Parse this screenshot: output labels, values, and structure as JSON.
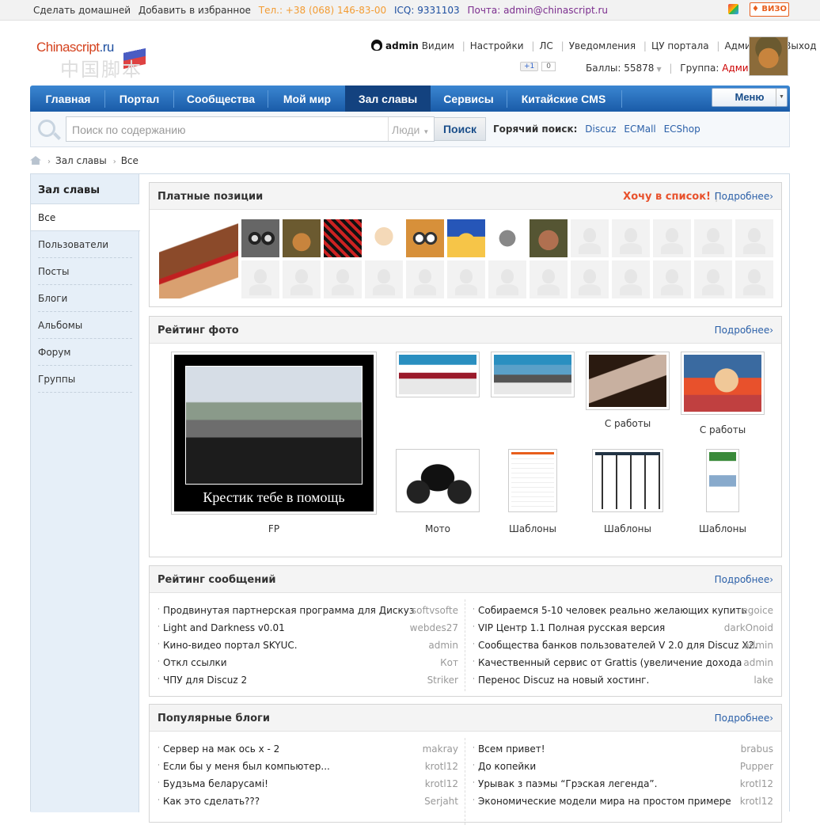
{
  "topbar": {
    "make_home": "Сделать домашней",
    "add_fav": "Добавить в избранное",
    "phone": "Тел.: +38 (068) 146-83-00",
    "icq": "ICQ: 9331103",
    "mail": "Почта: admin@chinascript.ru",
    "viz": "ВИЗО"
  },
  "logo": {
    "text_main": "Chinascript",
    "text_tld": ".ru",
    "text_sub": "中国脚本"
  },
  "user": {
    "name": "admin",
    "status": "Видим",
    "links": [
      "Настройки",
      "ЛС",
      "Уведомления",
      "ЦУ портала",
      "Админка",
      "Выход"
    ],
    "gplus": "+1",
    "gplus_count": "0",
    "points_label": "Баллы: 55878",
    "group_label": "Группа:",
    "group_value": "Админы"
  },
  "nav": {
    "items": [
      "Главная",
      "Портал",
      "Сообщества",
      "Мой мир",
      "Зал славы",
      "Сервисы",
      "Китайские CMS"
    ],
    "active": "Зал славы",
    "menu": "Меню"
  },
  "search": {
    "placeholder": "Поиск по содержанию",
    "type": "Люди",
    "button": "Поиск",
    "hot_label": "Горячий поиск:",
    "hot": [
      "Discuz",
      "ECMall",
      "ECShop"
    ]
  },
  "breadcrumb": [
    "Зал славы",
    "Все"
  ],
  "sidebar": {
    "title": "Зал славы",
    "active": "Все",
    "items": [
      "Пользователи",
      "Посты",
      "Блоги",
      "Альбомы",
      "Форум",
      "Группы"
    ]
  },
  "paid": {
    "title": "Платные позиции",
    "want": "Хочу в список!",
    "more": "Подробнее›"
  },
  "photos": {
    "title": "Рейтинг фото",
    "more": "Подробнее›",
    "main_caption_in_image": "Крестик тебе в помощь",
    "captions": [
      "FP",
      "С работы",
      "С работы",
      "Мото",
      "Шаблоны",
      "Шаблоны",
      "Шаблоны"
    ]
  },
  "messages": {
    "title": "Рейтинг сообщений",
    "more": "Подробнее›",
    "left": [
      {
        "text": "Продвинутая партнерская программа для Дискуз",
        "author": "softvsofte"
      },
      {
        "text": "Light and Darkness v0.01",
        "author": "webdes27"
      },
      {
        "text": "Кино-видео портал SKYUC.",
        "author": "admin"
      },
      {
        "text": "Откл ссылки",
        "author": "Кот"
      },
      {
        "text": "ЧПУ для Discuz 2",
        "author": "Striker"
      }
    ],
    "right": [
      {
        "text": "Собираемся 5-10 человек реально желающих купить",
        "author": "egoice"
      },
      {
        "text": "VIP Центр 1.1 Полная русская версия",
        "author": "darkOnoid"
      },
      {
        "text": "Сообщества банков пользователей V 2.0 для Discuz X2.",
        "author": "admin"
      },
      {
        "text": "Качественный сервис от Grattis (увеличение дохода",
        "author": "admin"
      },
      {
        "text": "Перенос Discuz на новый хостинг.",
        "author": "lake"
      }
    ]
  },
  "blogs": {
    "title": "Популярные блоги",
    "more": "Подробнее›",
    "left": [
      {
        "text": "Сервер на мак ось х - 2",
        "author": "makray"
      },
      {
        "text": "Если бы у меня был компьютер...",
        "author": "krotl12"
      },
      {
        "text": "Будзьма беларусамі!",
        "author": "krotl12"
      },
      {
        "text": "Как это сделать???",
        "author": "Serjaht"
      }
    ],
    "right": [
      {
        "text": "Всем привет!",
        "author": "brabus"
      },
      {
        "text": "До копейки",
        "author": "Pupper"
      },
      {
        "text": "Урывак з паэмы “Грэская легенда”.",
        "author": "krotl12"
      },
      {
        "text": "Экономические модели мира на простом примере",
        "author": "krotl12"
      }
    ]
  },
  "colors": {
    "nav": "#1a5ba8",
    "nav_active": "#13427f",
    "accent": "#e8512c",
    "link": "#2a5fa8",
    "sidebar": "#e6eff8"
  }
}
